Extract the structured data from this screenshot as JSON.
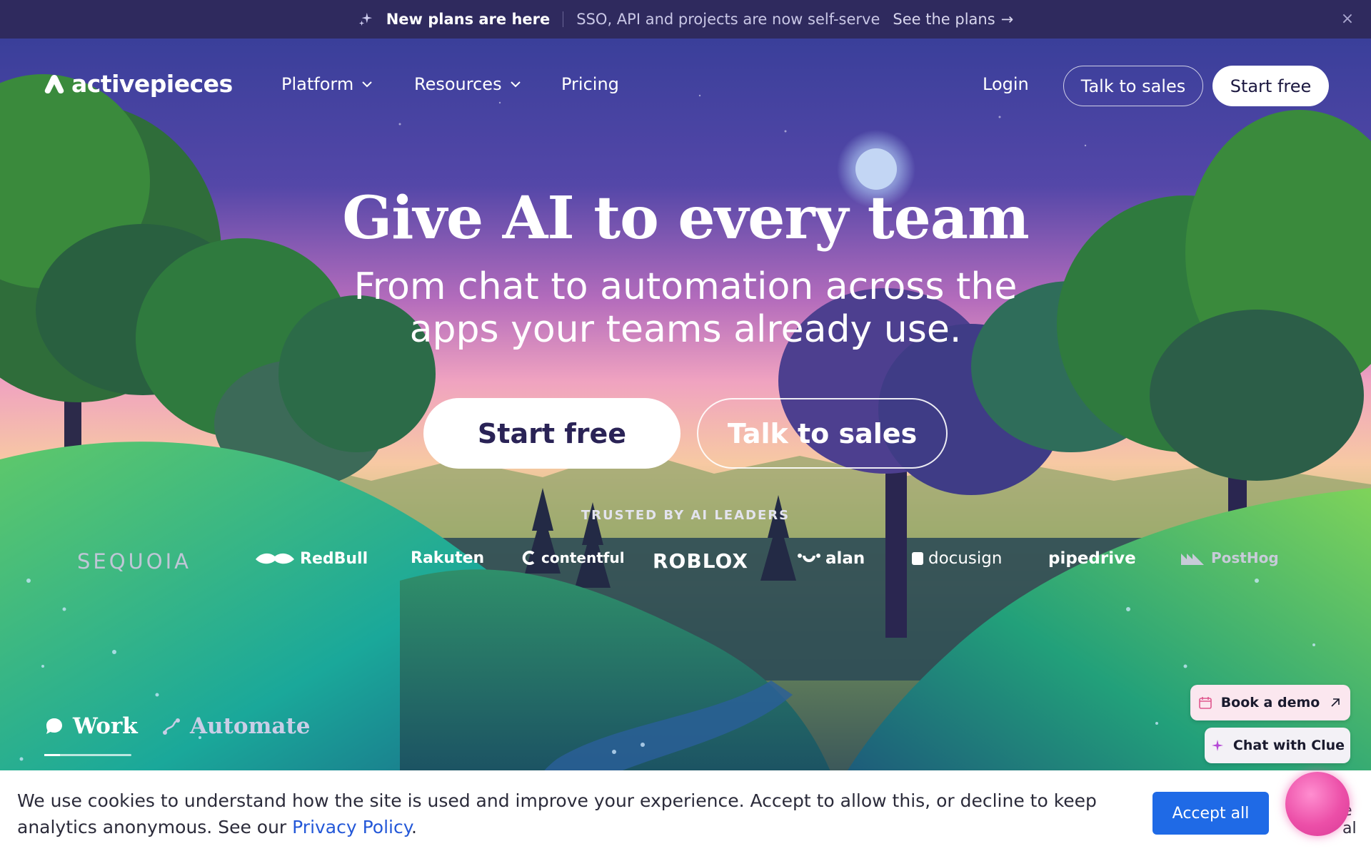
{
  "announcement": {
    "headline": "New plans are here",
    "detail": "SSO, API and projects are now self-serve",
    "link": "See the plans",
    "link_arrow": "→",
    "close": "×"
  },
  "nav": {
    "brand": "activepieces",
    "items": [
      {
        "label": "Platform",
        "has_dropdown": true
      },
      {
        "label": "Resources",
        "has_dropdown": true
      },
      {
        "label": "Pricing",
        "has_dropdown": false
      }
    ],
    "login": "Login",
    "talk_to_sales": "Talk to sales",
    "start_free": "Start free"
  },
  "hero": {
    "title": "Give AI to every team",
    "subtitle": "From chat to automation across the apps your teams already use.",
    "cta_primary": "Start free",
    "cta_secondary": "Talk to sales"
  },
  "trusted": {
    "label": "TRUSTED BY AI LEADERS",
    "brands": [
      "SEQUOIA",
      "RedBull",
      "Rakuten",
      "contentful",
      "ROBLOX",
      "alan",
      "docusign",
      "pipedrive",
      "PostHog"
    ]
  },
  "tabs": {
    "items": [
      {
        "label": "Work",
        "active": true
      },
      {
        "label": "Automate",
        "active": false
      }
    ]
  },
  "widgets": {
    "book_demo": "Book a demo",
    "chat_clue": "Chat with Clue"
  },
  "cookie": {
    "text": "We use cookies to understand how the site is used and improve your experience. Accept to allow this, or decline to keep analytics anonymous. See our ",
    "link": "Privacy Policy",
    "after": ".",
    "accept": "Accept all",
    "peek": "e al"
  },
  "colors": {
    "announce_bg": "#2f2a5e",
    "sky_top": "#3a3f9a",
    "sky_glow": "#f1a6c4",
    "primary_button": "#1f6ae6",
    "orb": "#ec4fa8"
  }
}
